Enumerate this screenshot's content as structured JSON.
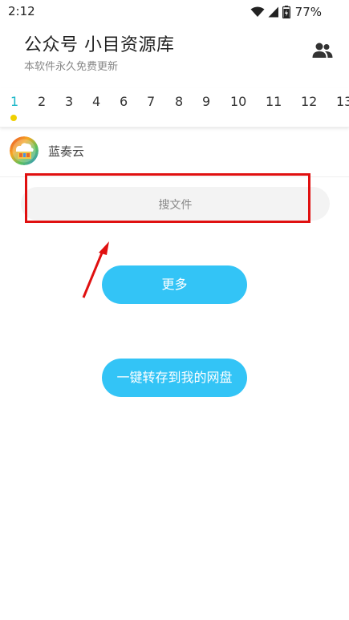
{
  "status_bar": {
    "time": "2:12",
    "battery": "77%"
  },
  "header": {
    "title": "公众号 小目资源库",
    "subtitle": "本软件永久免费更新"
  },
  "tabs": [
    "1",
    "2",
    "3",
    "4",
    "6",
    "7",
    "8",
    "9",
    "10",
    "11",
    "12",
    "13"
  ],
  "active_tab": "1",
  "colors": {
    "accent_tab": "#1bb7c8",
    "indicator": "#f0d000",
    "button": "#33c4f6",
    "highlight_box": "#e01010"
  },
  "source": {
    "label": "蓝奏云"
  },
  "search": {
    "placeholder": "搜文件"
  },
  "buttons": {
    "more": "更多",
    "save_to_disk": "一键转存到我的网盘"
  }
}
